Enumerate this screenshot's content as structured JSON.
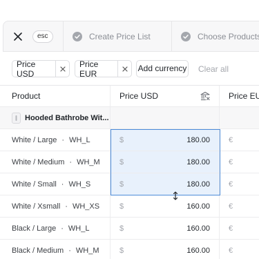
{
  "topbar": {
    "esc_label": "esc",
    "steps": [
      {
        "label": "Create Price List",
        "status": "completed"
      },
      {
        "label": "Choose Products",
        "status": "completed"
      }
    ]
  },
  "filters": {
    "chips": [
      {
        "label": "Price USD"
      },
      {
        "label": "Price EUR"
      }
    ],
    "add_label": "Add currency",
    "clear_label": "Clear all"
  },
  "table": {
    "headers": {
      "product": "Product",
      "usd": "Price USD",
      "eur": "Price EUR"
    },
    "group": {
      "name": "Hooded Bathrobe Wit..."
    },
    "currency_symbols": {
      "usd": "$",
      "eur": "€"
    },
    "rows": [
      {
        "variant": "White / Large",
        "sku": "WH_L",
        "usd": "180.00",
        "selected": true
      },
      {
        "variant": "White / Medium",
        "sku": "WH_M",
        "usd": "180.00",
        "selected": true
      },
      {
        "variant": "White / Small",
        "sku": "WH_S",
        "usd": "180.00",
        "selected": true
      },
      {
        "variant": "White / Xsmall",
        "sku": "WH_XS",
        "usd": "160.00",
        "selected": false
      },
      {
        "variant": "Black / Large",
        "sku": "WH_L",
        "usd": "160.00",
        "selected": false
      },
      {
        "variant": "Black / Medium",
        "sku": "WH_M",
        "usd": "160.00",
        "selected": false
      }
    ]
  },
  "colors": {
    "selection_fill": "#e8f1fc",
    "selection_border": "#4b8ad8"
  }
}
